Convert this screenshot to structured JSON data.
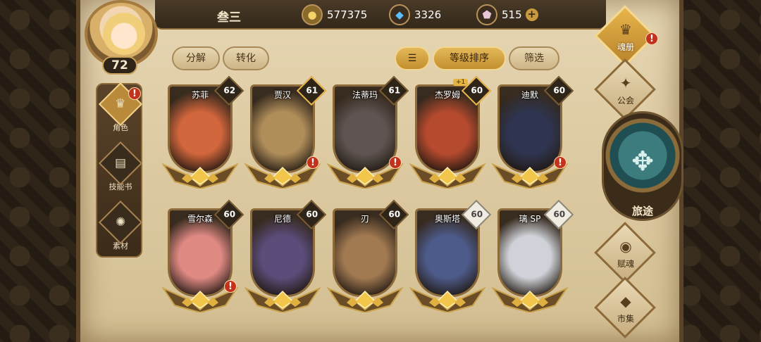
{
  "player": {
    "name": "叁三",
    "level": "72"
  },
  "currencies": [
    {
      "icon": "gold-coin-icon",
      "value": "577375"
    },
    {
      "icon": "blue-crystal-icon",
      "value": "3326"
    },
    {
      "icon": "pink-gem-icon",
      "value": "515"
    }
  ],
  "left_menu": [
    {
      "label": "角色",
      "icon": "helmet-icon",
      "active": true,
      "alert": "!"
    },
    {
      "label": "技能书",
      "icon": "book-icon",
      "active": false
    },
    {
      "label": "素材",
      "icon": "material-icon",
      "active": false
    }
  ],
  "actions": {
    "decompose": "分解",
    "convert": "转化",
    "sort_order": "等级排序",
    "filter": "筛选"
  },
  "cards": [
    {
      "name": "苏菲",
      "level": "62",
      "level_style": "dark",
      "alert": "",
      "color": "#d2663c"
    },
    {
      "name": "贾汉",
      "level": "61",
      "level_style": "gold",
      "alert": "!",
      "color": "#b08e5a"
    },
    {
      "name": "法蒂玛",
      "level": "61",
      "level_style": "dark",
      "alert": "!",
      "color": "#5e5552"
    },
    {
      "name": "杰罗姆",
      "level": "60",
      "level_style": "gold",
      "alert": "",
      "plus": "+1",
      "color": "#b54a2e"
    },
    {
      "name": "迪默",
      "level": "60",
      "level_style": "dark",
      "alert": "!",
      "color": "#2f3550"
    },
    {
      "name": "雪尔森",
      "level": "60",
      "level_style": "dark",
      "alert": "!",
      "color": "#e08a84"
    },
    {
      "name": "尼德",
      "level": "60",
      "level_style": "dark",
      "alert": "",
      "color": "#5b4c7a"
    },
    {
      "name": "刃",
      "level": "60",
      "level_style": "dark",
      "alert": "",
      "color": "#a27a52"
    },
    {
      "name": "奥斯塔",
      "level": "60",
      "level_style": "silver",
      "alert": "",
      "color": "#4d5b8a"
    },
    {
      "name": "璃 SP",
      "level": "60",
      "level_style": "silver",
      "alert": "",
      "color": "#cfd2d8"
    }
  ],
  "right_menu": [
    {
      "label": "魂册",
      "glyph": "♛",
      "active": true,
      "alert": "!"
    },
    {
      "label": "公会",
      "glyph": "✦",
      "active": false
    },
    {
      "label": "赋魂",
      "glyph": "◉",
      "active": false
    },
    {
      "label": "市集",
      "glyph": "◆",
      "active": false
    }
  ],
  "journey": {
    "label": "旅途",
    "glyph": "✥"
  }
}
